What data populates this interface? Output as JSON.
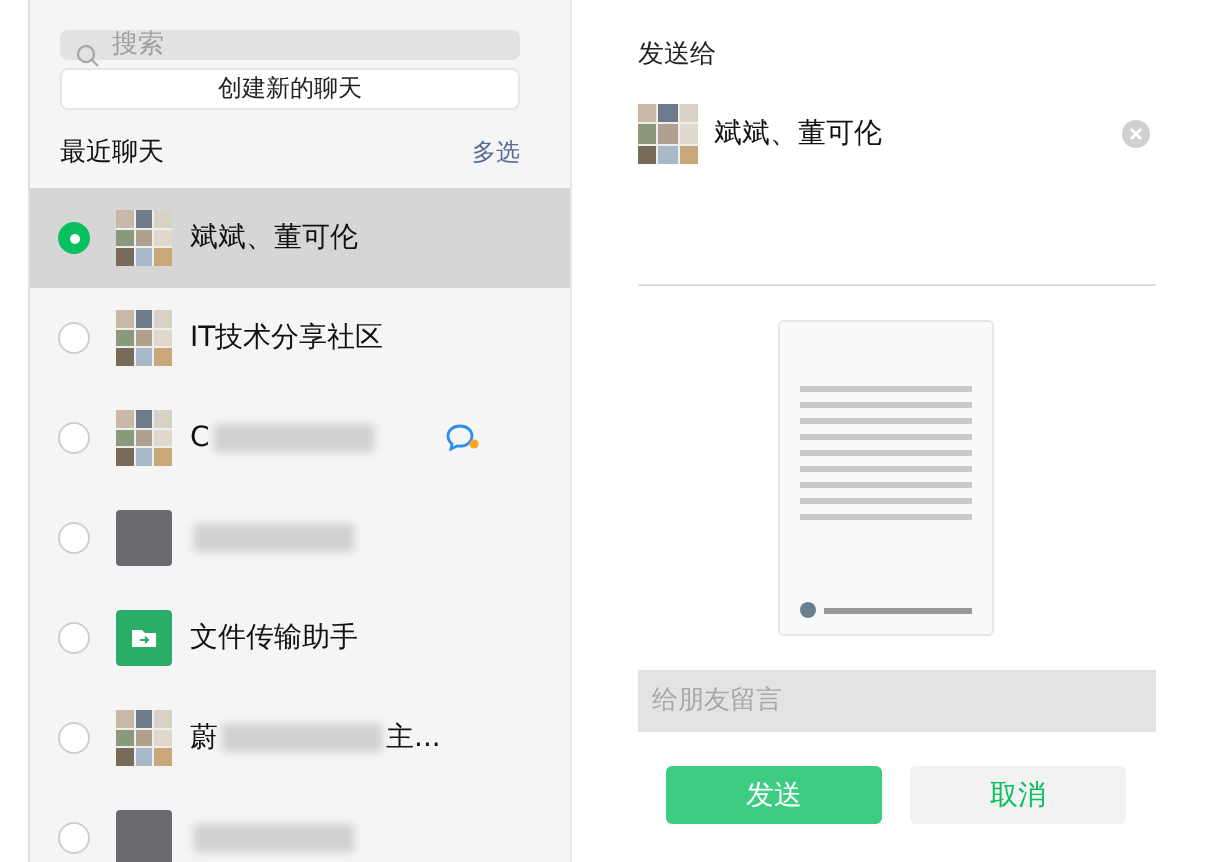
{
  "search": {
    "placeholder": "搜索"
  },
  "create_button": "创建新的聊天",
  "recent": {
    "title": "最近聊天",
    "multi_select": "多选"
  },
  "chats": [
    {
      "name": "斌斌、董可伦",
      "kind": "group",
      "selected": true,
      "blurred": false,
      "chat_icon": false
    },
    {
      "name": "IT技术分享社区",
      "kind": "group",
      "selected": false,
      "blurred": false,
      "chat_icon": false
    },
    {
      "name": "C",
      "kind": "group",
      "selected": false,
      "blurred": true,
      "chat_icon": true
    },
    {
      "kind": "photo",
      "selected": false,
      "blurred": true,
      "chat_icon": false
    },
    {
      "name": "文件传输助手",
      "kind": "file",
      "selected": false,
      "blurred": false,
      "chat_icon": false
    },
    {
      "name": "蔚",
      "name_tail": "主...",
      "kind": "group",
      "selected": false,
      "blurred": true,
      "chat_icon": false
    },
    {
      "kind": "photo",
      "selected": false,
      "blurred": true,
      "chat_icon": false
    }
  ],
  "send_to": {
    "title": "发送给",
    "recipient": {
      "name": "斌斌、董可伦",
      "kind": "group"
    }
  },
  "message": {
    "placeholder": "给朋友留言"
  },
  "buttons": [
    {
      "label": "发送",
      "kind": "primary"
    },
    {
      "label": "取消",
      "kind": "secondary"
    }
  ]
}
